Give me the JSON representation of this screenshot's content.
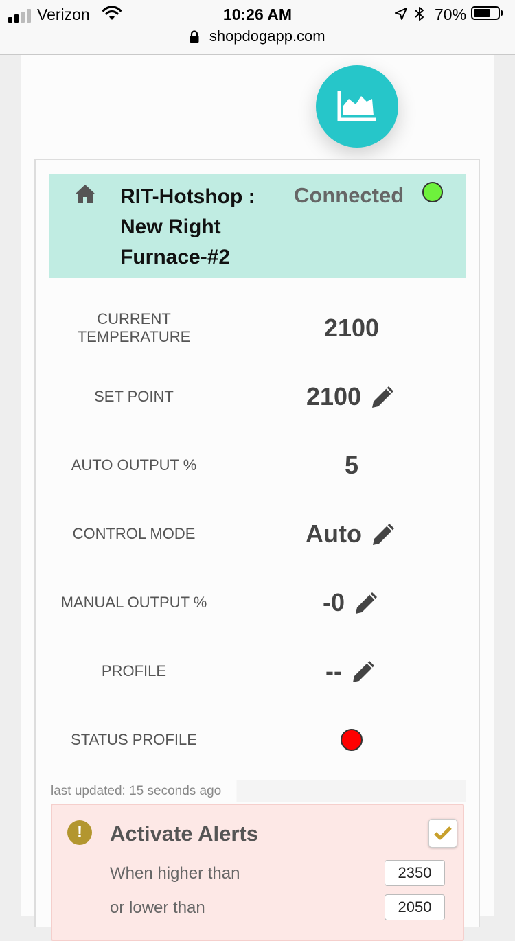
{
  "status_bar": {
    "carrier": "Verizon",
    "time": "10:26 AM",
    "battery": "70%",
    "battery_level": 0.7
  },
  "browser": {
    "url": "shopdogapp.com"
  },
  "device": {
    "name": "RIT-Hotshop : New Right Furnace-#2",
    "connection_status": "Connected",
    "connection_color": "#6ef13c"
  },
  "readings": {
    "current_temperature": {
      "label": "CURRENT TEMPERATURE",
      "value": "2100"
    },
    "set_point": {
      "label": "SET POINT",
      "value": "2100"
    },
    "auto_output": {
      "label": "AUTO OUTPUT %",
      "value": "5"
    },
    "control_mode": {
      "label": "CONTROL MODE",
      "value": "Auto"
    },
    "manual_output": {
      "label": "MANUAL OUTPUT %",
      "value": "-0"
    },
    "profile": {
      "label": "PROFILE",
      "value": "--"
    },
    "status_profile": {
      "label": "STATUS PROFILE",
      "indicator_color": "#ff0000"
    }
  },
  "last_updated": "last updated: 15 seconds ago",
  "alerts": {
    "title": "Activate Alerts",
    "enabled": true,
    "higher_label": "When higher than",
    "higher_value": "2350",
    "lower_label": "or lower than",
    "lower_value": "2050"
  },
  "colors": {
    "accent": "#26c6c9",
    "header_bg": "#c0ece2",
    "alert_bg": "#fde8e6",
    "alert_icon": "#b3962f"
  }
}
